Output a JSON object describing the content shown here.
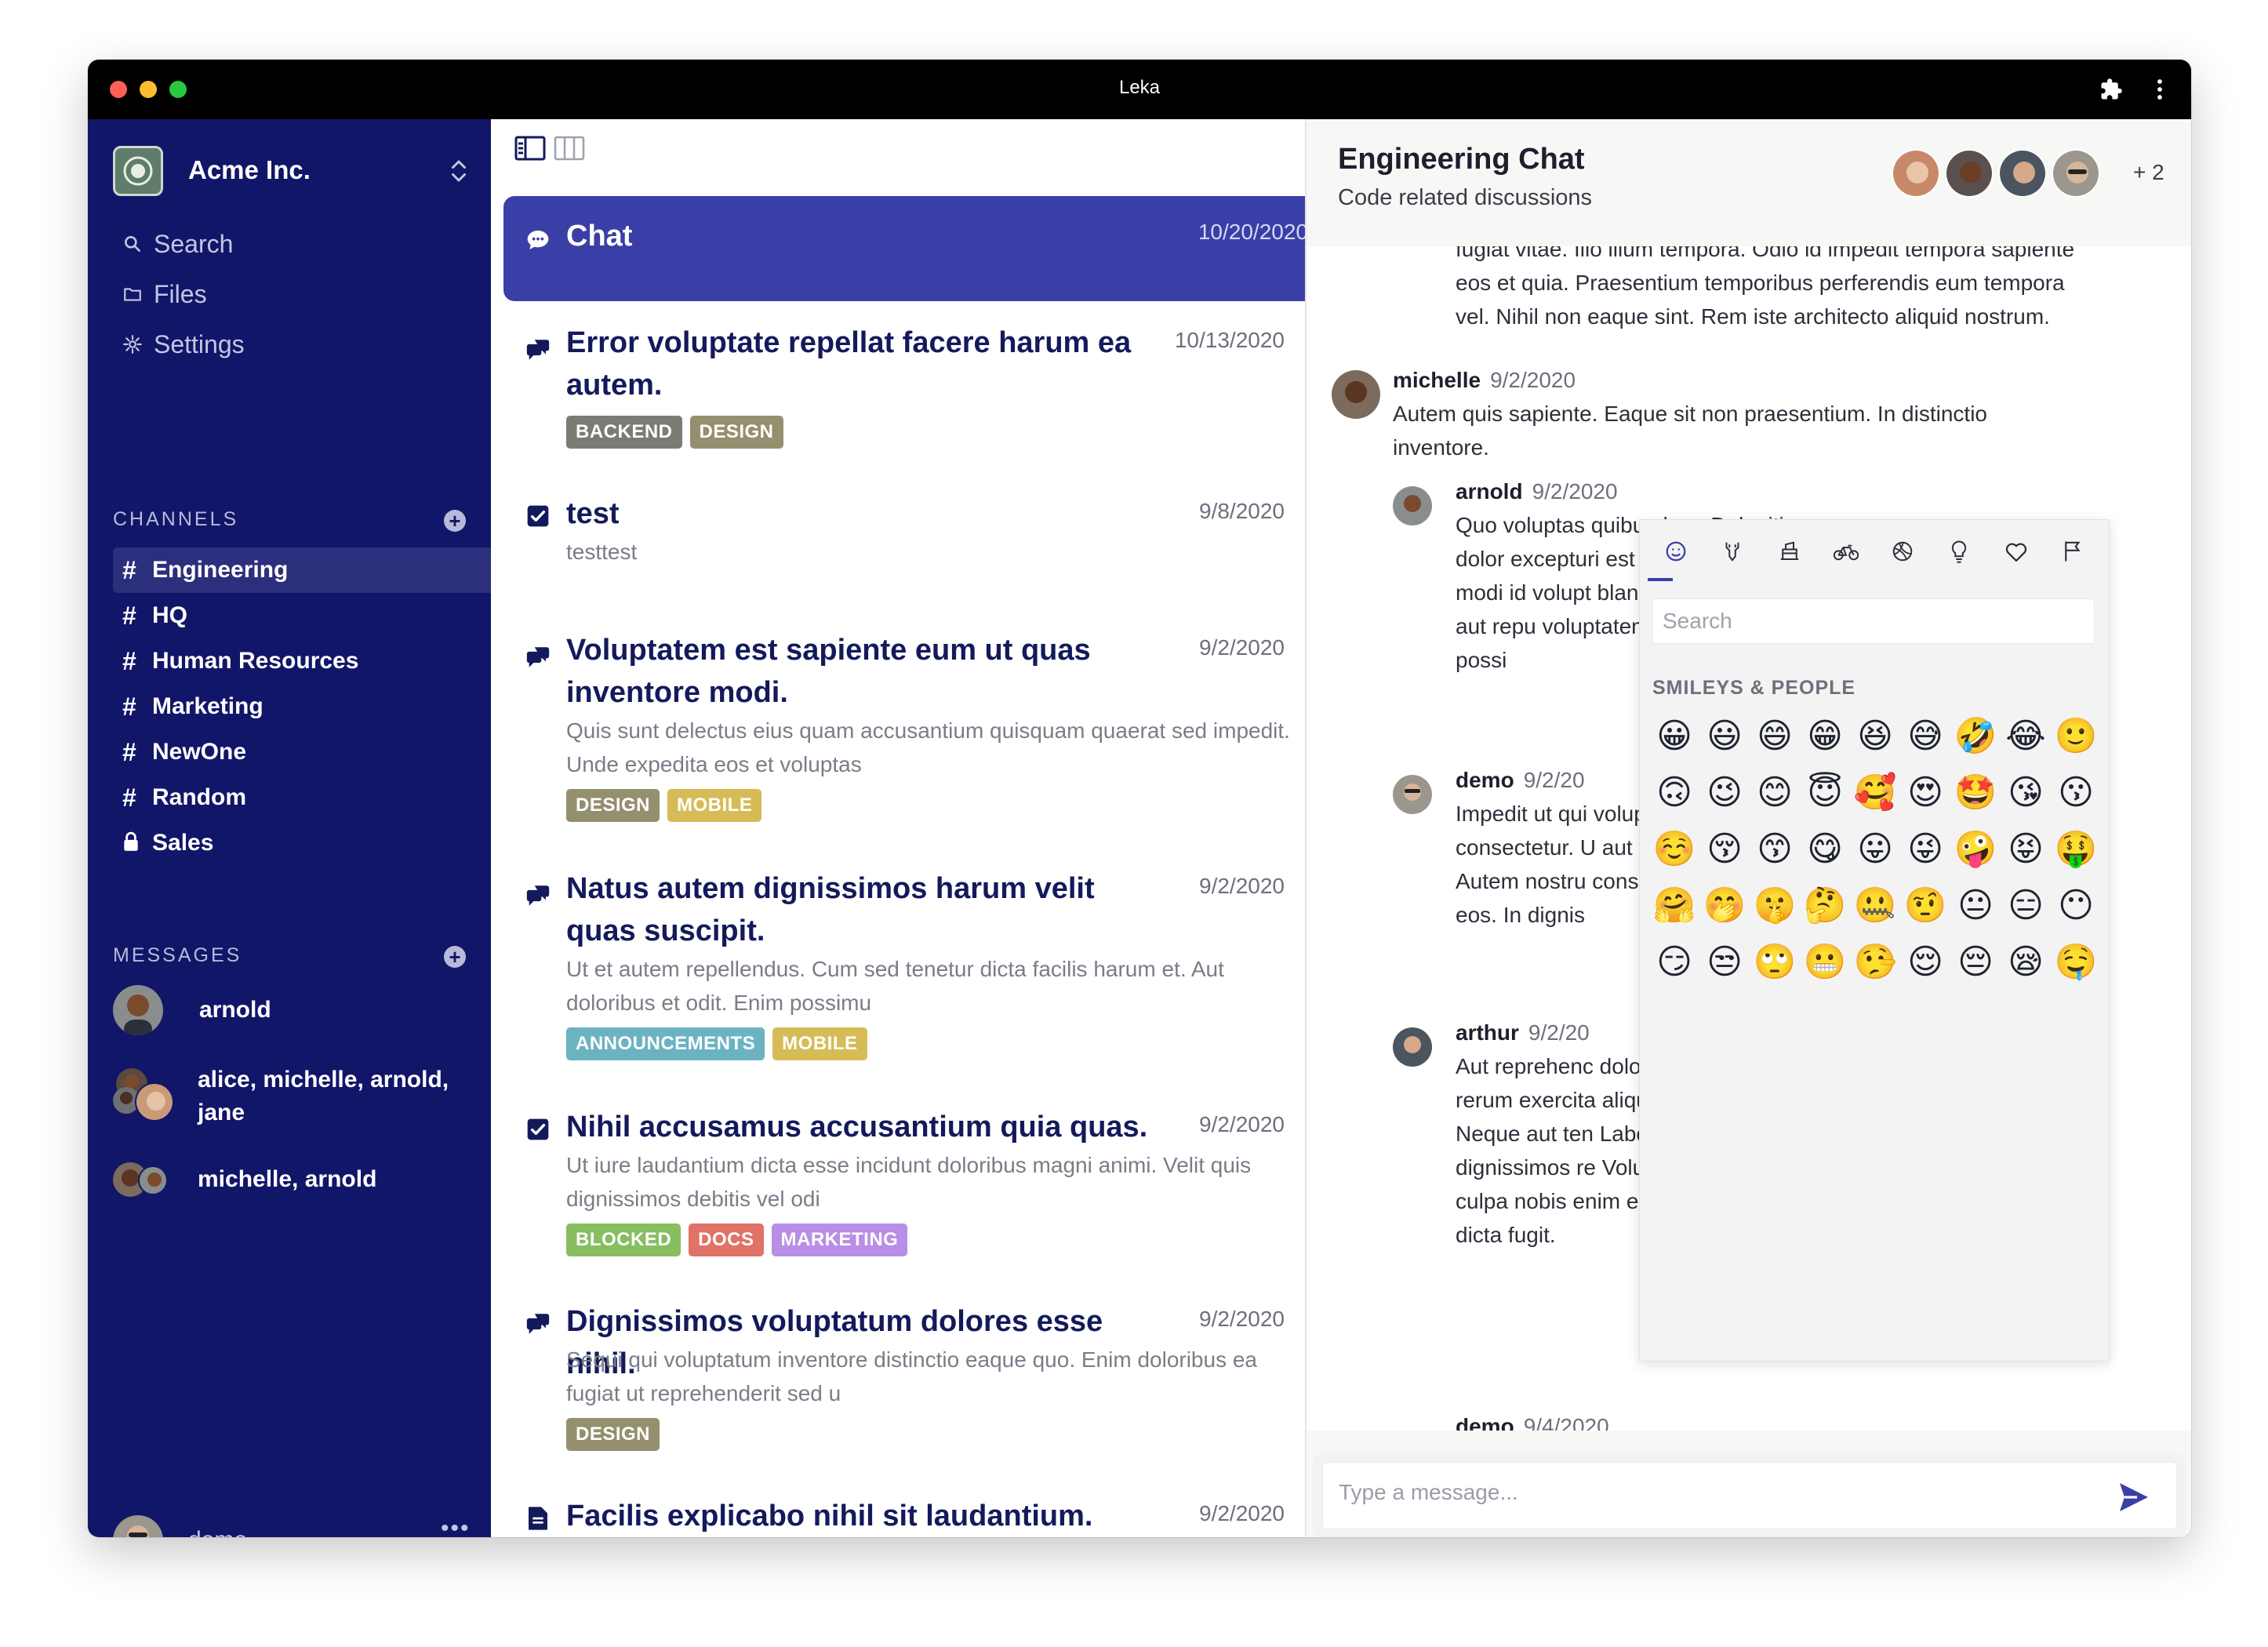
{
  "window": {
    "title": "Leka"
  },
  "workspace": {
    "name": "Acme Inc."
  },
  "nav": [
    {
      "label": "Search",
      "icon": "search-icon"
    },
    {
      "label": "Files",
      "icon": "folder-icon"
    },
    {
      "label": "Settings",
      "icon": "gear-icon"
    }
  ],
  "channels": {
    "title": "CHANNELS",
    "items": [
      {
        "label": "Engineering",
        "icon": "hash-icon",
        "active": true
      },
      {
        "label": "HQ",
        "icon": "hash-icon"
      },
      {
        "label": "Human Resources",
        "icon": "hash-icon"
      },
      {
        "label": "Marketing",
        "icon": "hash-icon"
      },
      {
        "label": "NewOne",
        "icon": "hash-icon"
      },
      {
        "label": "Random",
        "icon": "hash-icon"
      },
      {
        "label": "Sales",
        "icon": "lock-icon"
      }
    ]
  },
  "messages_section": {
    "title": "MESSAGES",
    "items": [
      {
        "label": "arnold"
      },
      {
        "label": "alice, michelle, arnold, jane"
      },
      {
        "label": "michelle, arnold"
      }
    ]
  },
  "current_user": {
    "name": "demo",
    "more": "•••"
  },
  "list": [
    {
      "icon": "chat-icon",
      "title": "Chat",
      "date": "10/20/2020",
      "body": "",
      "tags": [],
      "active": true
    },
    {
      "icon": "discussion-icon",
      "title": "Error voluptate repellat facere harum ea autem.",
      "date": "10/13/2020",
      "body": "",
      "tags": [
        "BACKEND",
        "DESIGN"
      ]
    },
    {
      "icon": "checkbox-icon",
      "title": "test",
      "date": "9/8/2020",
      "body": "testtest",
      "tags": []
    },
    {
      "icon": "discussion-icon",
      "title": "Voluptatem est sapiente eum ut quas inventore modi.",
      "date": "9/2/2020",
      "body": "Quis sunt delectus eius quam accusantium quisquam quaerat sed impedit. Unde expedita eos et voluptas",
      "tags": [
        "DESIGN",
        "MOBILE"
      ]
    },
    {
      "icon": "discussion-icon",
      "title": "Natus autem dignissimos harum velit quas suscipit.",
      "date": "9/2/2020",
      "body": "Ut et autem repellendus. Cum sed tenetur dicta facilis harum et. Aut doloribus et odit. Enim possimu",
      "tags": [
        "ANNOUNCEMENTS",
        "MOBILE"
      ]
    },
    {
      "icon": "checkbox-icon",
      "title": "Nihil accusamus accusantium quia quas.",
      "date": "9/2/2020",
      "body": "Ut iure laudantium dicta esse incidunt doloribus magni animi. Velit quis dignissimos debitis vel odi",
      "tags": [
        "BLOCKED",
        "DOCS",
        "MARKETING"
      ]
    },
    {
      "icon": "discussion-icon",
      "title": "Dignissimos voluptatum dolores esse nihil.",
      "date": "9/2/2020",
      "body": "Sequi qui voluptatum inventore distinctio eaque quo. Enim doloribus ea fugiat ut reprehenderit sed u",
      "tags": [
        "DESIGN"
      ]
    },
    {
      "icon": "document-icon",
      "title": "Facilis explicabo nihil sit laudantium.",
      "date": "9/2/2020",
      "body": "",
      "tags": []
    }
  ],
  "tag_colors": {
    "BACKEND": "#7a7b75",
    "DESIGN": "#94906f",
    "MOBILE": "#d6bc56",
    "ANNOUNCEMENTS": "#6cb3c2",
    "BLOCKED": "#88bd62",
    "DOCS": "#e07268",
    "MARKETING": "#b98ee6"
  },
  "chat": {
    "title": "Engineering Chat",
    "subtitle": "Code related discussions",
    "members_more": "+ 2",
    "messages": [
      {
        "author": "",
        "time": "",
        "text": "fugiat vitae. Illo illum tempora. Odio id impedit tempora sapiente eos et quia. Praesentium temporibus perferendis eum tempora vel. Nihil non eaque sint. Rem iste architecto aliquid nostrum."
      },
      {
        "author": "michelle",
        "time": "9/2/2020",
        "text": "Autem quis sapiente. Eaque sit non praesentium. In distinctio inventore."
      },
      {
        "author": "arnold",
        "time": "9/2/2020",
        "text": "Quo voluptas quibusdam. Deleniti dolor excepturi est velit qui ration modi id volupt blanditiis sapi Et sit aut repu voluptatem. Ip dolorem possi"
      },
      {
        "author": "demo",
        "time": "9/2/20",
        "text": "Impedit ut qui voluptatum ius consectetur. U aut fuga itaqu Autem nostru consequatur v eos. In dignis"
      },
      {
        "author": "arthur",
        "time": "9/2/20",
        "text": "Aut reprehenc dolorem iusto rerum exercita aliquam accus Neque aut ten Laborum exce dignissimos re Voluptates vel sit culpa nobis enim exercitationem dicta fugit."
      },
      {
        "author": "demo",
        "time": "9/4/2020",
        "text": ""
      }
    ],
    "composer_placeholder": "Type a message..."
  },
  "emoji_picker": {
    "search_placeholder": "Search",
    "category_title": "SMILEYS & PEOPLE",
    "tabs": [
      "smiley-icon",
      "animal-icon",
      "food-icon",
      "bike-icon",
      "ball-icon",
      "bulb-icon",
      "heart-icon",
      "flag-icon"
    ],
    "emojis": [
      "😀",
      "😃",
      "😄",
      "😁",
      "😆",
      "😅",
      "🤣",
      "😂",
      "🙂",
      "🙃",
      "😉",
      "😊",
      "😇",
      "🥰",
      "😍",
      "🤩",
      "😘",
      "😗",
      "☺️",
      "😚",
      "😙",
      "😋",
      "😛",
      "😜",
      "🤪",
      "😝",
      "🤑",
      "🤗",
      "🤭",
      "🤫",
      "🤔",
      "🤐",
      "🤨",
      "😐",
      "😑",
      "😶",
      "😏",
      "😒",
      "🙄",
      "😬",
      "🤥",
      "😌",
      "😔",
      "😪",
      "🤤",
      "😴",
      "😷",
      "🤒",
      "🤕",
      "🤢",
      "🤮",
      "🤧",
      "🥵",
      "🥶",
      "🥴",
      "😵",
      "🤯",
      "🤠",
      "🥳",
      "😎",
      "🤓",
      "🧐",
      "😕",
      "😟",
      "🙁",
      "☹️",
      "😮",
      "😯",
      "😲",
      "😳",
      "🥺",
      "😦",
      "😧",
      "😨",
      "😰",
      "😥",
      "😢",
      "😭",
      "😱",
      "😖",
      "😣",
      "😞",
      "😓",
      "😩",
      "😫",
      "🥱",
      "😤",
      "😡",
      "😠",
      "🤬"
    ]
  }
}
